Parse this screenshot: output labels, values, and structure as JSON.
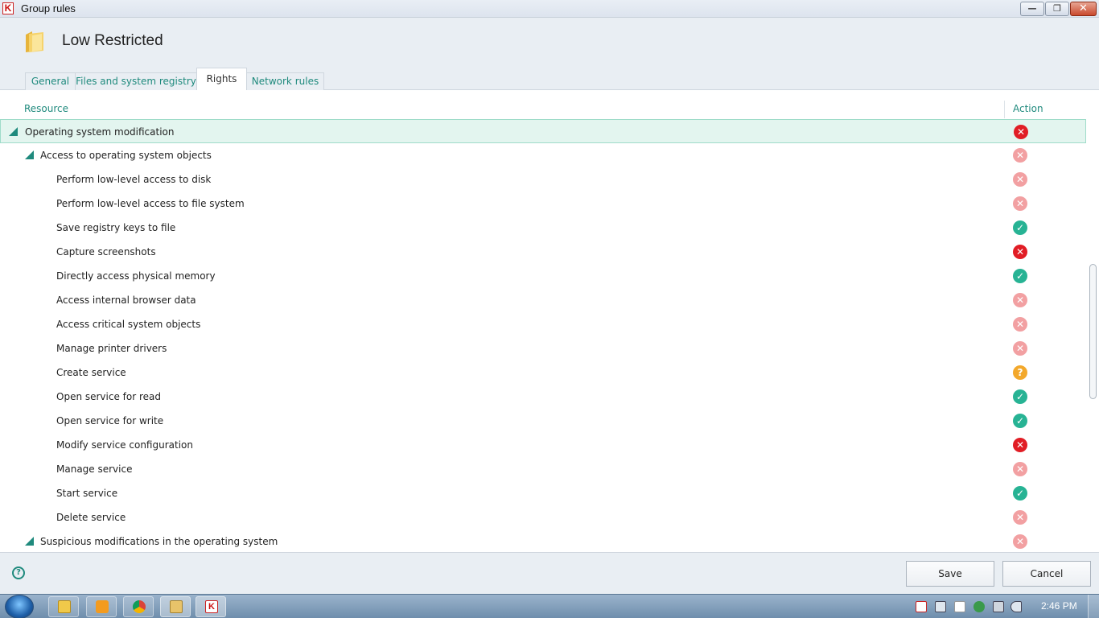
{
  "window": {
    "title": "Group rules",
    "min_glyph": "—",
    "max_glyph": "❐",
    "close_glyph": "✕",
    "app_glyph": "K"
  },
  "header": {
    "title": "Low Restricted"
  },
  "tabs": [
    {
      "label": "General"
    },
    {
      "label": "Files and system registry"
    },
    {
      "label": "Rights"
    },
    {
      "label": "Network rules"
    }
  ],
  "table": {
    "columns": {
      "resource": "Resource",
      "action": "Action"
    },
    "rows": [
      {
        "label": "Operating system modification",
        "level": 0,
        "action": "block",
        "selected": true
      },
      {
        "label": "Access to operating system objects",
        "level": 1,
        "action": "block-inherited"
      },
      {
        "label": "Perform low-level access to disk",
        "level": 2,
        "action": "block-inherited"
      },
      {
        "label": "Perform low-level access to file system",
        "level": 2,
        "action": "block-inherited"
      },
      {
        "label": "Save registry keys to file",
        "level": 2,
        "action": "allow"
      },
      {
        "label": "Capture screenshots",
        "level": 2,
        "action": "block"
      },
      {
        "label": "Directly access physical memory",
        "level": 2,
        "action": "allow"
      },
      {
        "label": "Access internal browser data",
        "level": 2,
        "action": "block-inherited"
      },
      {
        "label": "Access critical system objects",
        "level": 2,
        "action": "block-inherited"
      },
      {
        "label": "Manage printer drivers",
        "level": 2,
        "action": "block-inherited"
      },
      {
        "label": "Create service",
        "level": 2,
        "action": "prompt"
      },
      {
        "label": "Open service for read",
        "level": 2,
        "action": "allow"
      },
      {
        "label": "Open service for write",
        "level": 2,
        "action": "allow"
      },
      {
        "label": "Modify service configuration",
        "level": 2,
        "action": "block"
      },
      {
        "label": "Manage service",
        "level": 2,
        "action": "block-inherited"
      },
      {
        "label": "Start service",
        "level": 2,
        "action": "allow"
      },
      {
        "label": "Delete service",
        "level": 2,
        "action": "block-inherited"
      },
      {
        "label": "Suspicious modifications in the operating system",
        "level": 1,
        "action": "block-inherited"
      }
    ]
  },
  "action_icons": {
    "block": {
      "glyph": "✕",
      "icon": "block-icon",
      "color": "#e11d25"
    },
    "block-inherited": {
      "glyph": "✕",
      "icon": "block-inherited-icon",
      "color": "#f2a0a2"
    },
    "allow": {
      "glyph": "✓",
      "icon": "allow-icon",
      "color": "#27b394"
    },
    "prompt": {
      "glyph": "?",
      "icon": "prompt-icon",
      "color": "#f3a82b"
    }
  },
  "footer": {
    "help_glyph": "?",
    "save_label": "Save",
    "cancel_label": "Cancel"
  },
  "taskbar": {
    "apps": [
      "explorer-icon",
      "media-player-icon",
      "chrome-icon",
      "application-icon",
      "kaspersky-icon"
    ],
    "clock": "2:46 PM"
  },
  "colors": {
    "accent": "#1f8a7d",
    "selected_row": "#e3f5ef"
  }
}
